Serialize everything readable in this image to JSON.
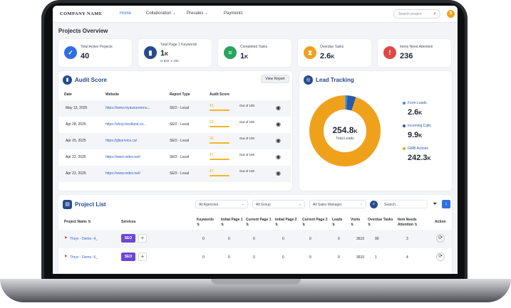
{
  "nav": {
    "brand": "COMPANY NAME",
    "items": [
      {
        "label": "Home"
      },
      {
        "label": "Collaboration",
        "caret": "⌄"
      },
      {
        "label": "Presales",
        "caret": "⌄"
      },
      {
        "label": "Payments"
      }
    ],
    "search_placeholder": "Search project",
    "avatar": "S"
  },
  "page_title": "Projects Overview",
  "stats": [
    {
      "label": "Total Active Projects",
      "value": "40",
      "icon": "check-circle-icon",
      "color": "#2f6fe0"
    },
    {
      "label": "Total Page 1 Keywords",
      "value": "1",
      "unit": "K",
      "google": "822",
      "bing": "181",
      "icon": "bar-chart-icon",
      "color": "#264b8c"
    },
    {
      "label": "Completed Tasks",
      "value": "1",
      "unit": "K",
      "icon": "clipboard-icon",
      "color": "#27a45f"
    },
    {
      "label": "Overdue Tasks",
      "value": "2.6",
      "unit": "K",
      "icon": "hourglass-icon",
      "color": "#f0a11c"
    },
    {
      "label": "Items Need Attention",
      "value": "236",
      "icon": "warning-icon",
      "color": "#e04848"
    }
  ],
  "audit": {
    "title": "Audit Score",
    "view_report": "View Report",
    "headers": {
      "date": "Date",
      "website": "Website",
      "report_type": "Report Type",
      "audit_score": "Audit Score"
    },
    "rows": [
      {
        "date": "May 13, 2025",
        "website": "https://www.myassurerenu...",
        "type": "SEO - Local",
        "score": "41",
        "out_of": "Out of 100"
      },
      {
        "date": "Apr 28, 2025",
        "website": "https://shop.foodland.co...",
        "type": "SEO - Local",
        "score": "63",
        "out_of": "Out of 100"
      },
      {
        "date": "Apr 25, 2025",
        "website": "https://gltservice.ca/",
        "type": "SEO - Local",
        "score": "32",
        "out_of": "Out of 100"
      },
      {
        "date": "Apr 22, 2025",
        "website": "https://www.redev.net/",
        "type": "SEO - Local",
        "score": "47",
        "out_of": "Out of 100"
      },
      {
        "date": "Apr 22, 2025",
        "website": "https://www.redev.net/",
        "type": "SEO - Local",
        "score": "47",
        "out_of": "Out of 100"
      }
    ]
  },
  "lead": {
    "title": "Lead Tracking",
    "total_value": "254.8",
    "total_unit": "K",
    "total_label": "Total Leads",
    "segments": [
      {
        "label": "Form Leads",
        "value": "2.6",
        "unit": "K",
        "color": "#2f8fe0"
      },
      {
        "label": "Incoming Calls",
        "value": "9.9",
        "unit": "K",
        "color": "#2a5aa6"
      },
      {
        "label": "GMB Actions",
        "value": "242.3",
        "unit": "K",
        "color": "#f0a11c"
      }
    ],
    "segment_numbers": [
      2.6,
      9.9,
      242.3
    ]
  },
  "projects": {
    "title": "Project List",
    "filters": {
      "agencies": "All Agencies",
      "group": "All Group",
      "sales_manager": "All Sales Manager",
      "search": "Search..."
    },
    "headers": {
      "name": "Project Name",
      "services": "Services",
      "keywords": "Keywords",
      "initial1": "Initial Page 1",
      "current1": "Current Page 1",
      "initial2": "Initial Page 2",
      "current2": "Current Page 2",
      "leads": "Leads",
      "visits": "Visits",
      "overdue": "Overdue Tasks",
      "attention": "Item Needs Attention",
      "action": "Action"
    },
    "sort_icon": "⇅",
    "rows": [
      {
        "name": "Thryv - Demo -4_",
        "service": "SEO",
        "keywords": "0",
        "initial1": "0",
        "current1": "0",
        "initial2": "0",
        "current2": "0",
        "leads": "0",
        "visits": "3610",
        "overdue": "99",
        "attention": "3"
      },
      {
        "name": "Thryv - Demo -5_",
        "service": "SEO",
        "keywords": "0",
        "initial1": "0",
        "current1": "0",
        "initial2": "0",
        "current2": "0",
        "leads": "0",
        "visits": "3610",
        "overdue": "1",
        "attention": "4"
      }
    ]
  }
}
